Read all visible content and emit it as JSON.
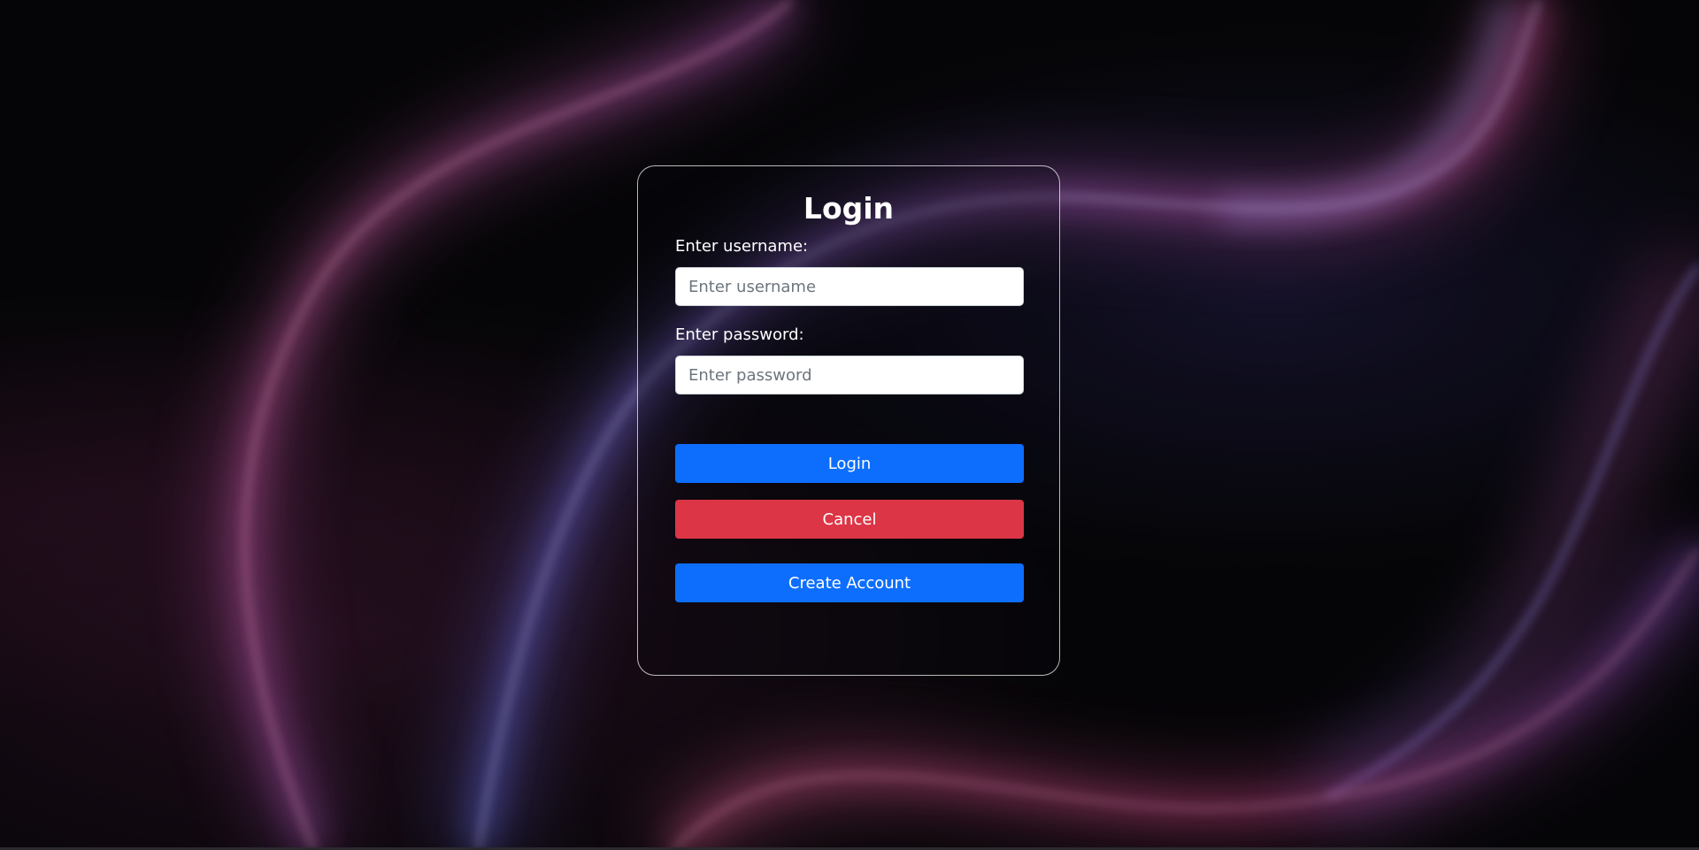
{
  "login_form": {
    "title": "Login",
    "username_label": "Enter username:",
    "username_placeholder": "Enter username",
    "username_value": "",
    "password_label": "Enter password:",
    "password_placeholder": "Enter password",
    "password_value": "",
    "login_button_label": "Login",
    "cancel_button_label": "Cancel",
    "create_account_button_label": "Create Account"
  },
  "colors": {
    "primary_button": "#0d6efd",
    "danger_button": "#dc3545",
    "card_border": "#ffffff",
    "background": "#050507",
    "wave_pink": "#c2417e",
    "wave_blue": "#6a6fd8"
  }
}
